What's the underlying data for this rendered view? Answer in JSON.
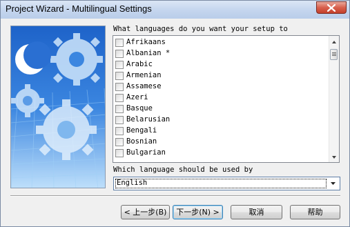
{
  "window": {
    "title": "Project Wizard - Multilingual Settings"
  },
  "main": {
    "prompt": "What languages do you want your setup to",
    "languages": [
      {
        "label": "Afrikaans",
        "checked": false
      },
      {
        "label": "Albanian *",
        "checked": false
      },
      {
        "label": "Arabic",
        "checked": false
      },
      {
        "label": "Armenian",
        "checked": false
      },
      {
        "label": "Assamese",
        "checked": false
      },
      {
        "label": "Azeri",
        "checked": false
      },
      {
        "label": "Basque",
        "checked": false
      },
      {
        "label": "Belarusian",
        "checked": false
      },
      {
        "label": "Bengali",
        "checked": false
      },
      {
        "label": "Bosnian",
        "checked": false
      },
      {
        "label": "Bulgarian",
        "checked": false
      }
    ],
    "default_prompt": "Which language should be used by",
    "default_language": "English"
  },
  "buttons": {
    "back": "< 上一步(B)",
    "next": "下一步(N) >",
    "cancel": "取消",
    "help": "帮助"
  }
}
